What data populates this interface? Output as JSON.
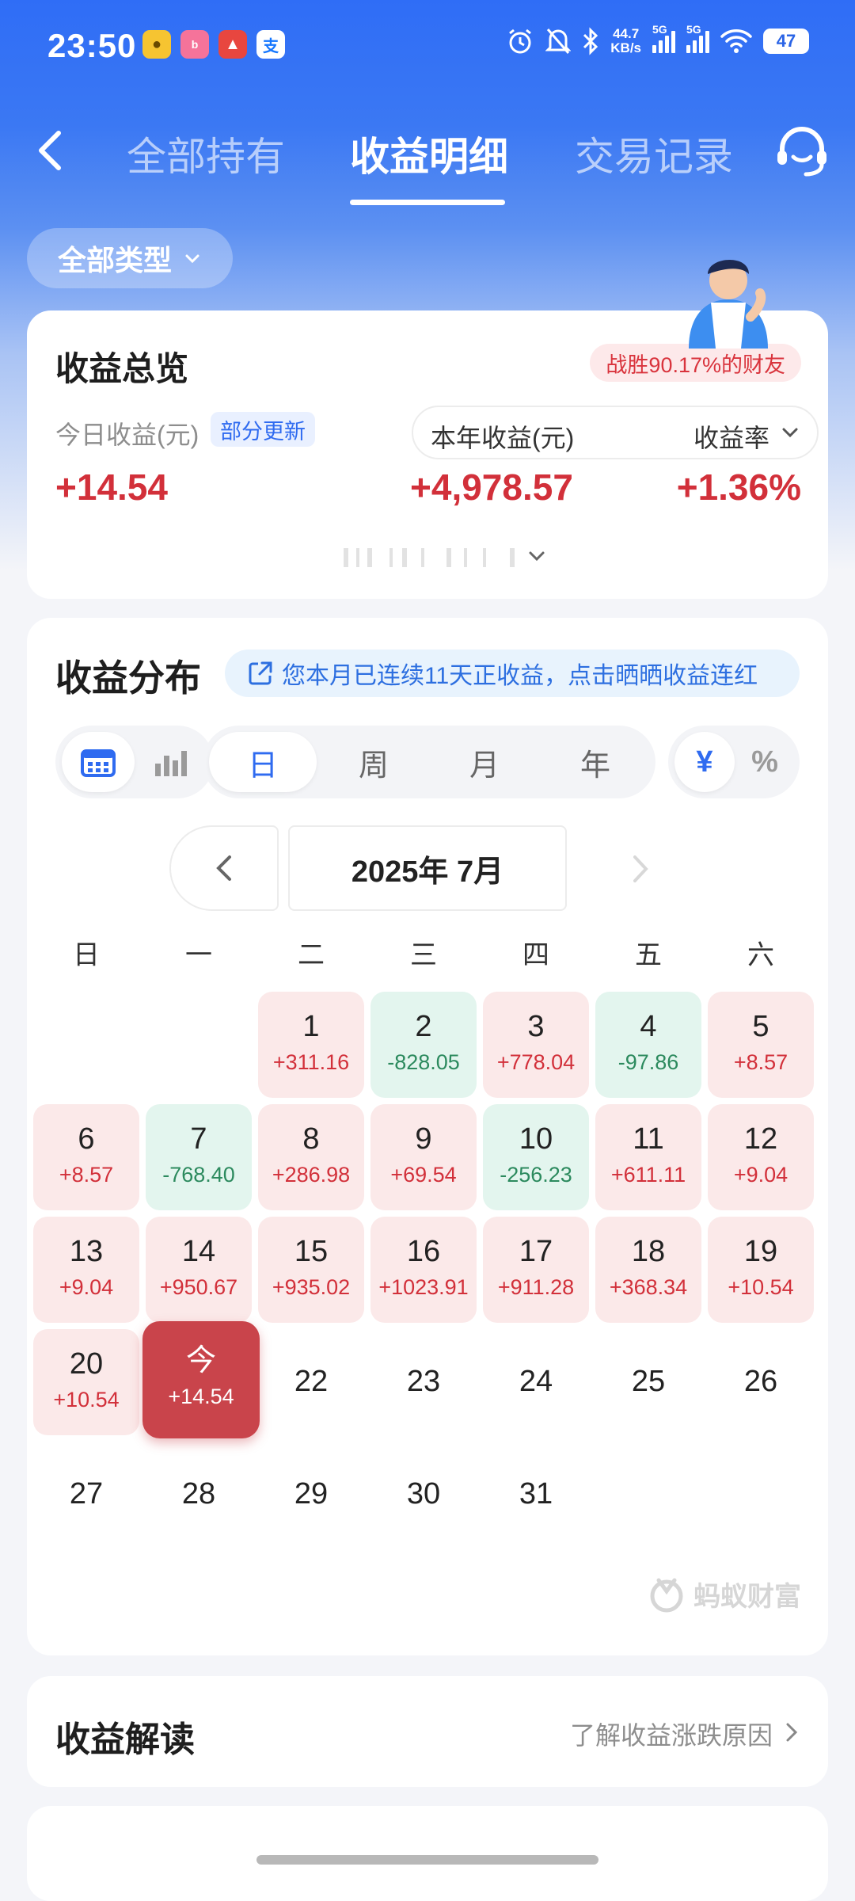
{
  "status_bar": {
    "time": "23:50",
    "net_speed_value": "44.7",
    "net_speed_unit": "KB/s",
    "signal_1": "5G",
    "signal_2": "5G",
    "battery": "47",
    "app_icons": [
      "calendar-app-icon",
      "bilibili-app-icon",
      "toutiao-app-icon",
      "alipay-app-icon"
    ],
    "status_icons": [
      "alarm-icon",
      "mute-bell-icon",
      "bluetooth-icon",
      "wifi-icon"
    ]
  },
  "nav": {
    "tabs": [
      {
        "label": "全部持有",
        "active": false
      },
      {
        "label": "收益明细",
        "active": true
      },
      {
        "label": "交易记录",
        "active": false
      }
    ]
  },
  "filter": {
    "type_label": "全部类型"
  },
  "overview": {
    "title": "收益总览",
    "beat_badge": "战胜90.17%的财友",
    "today_label": "今日收益(元)",
    "partial_badge": "部分更新",
    "today_value": "+14.54",
    "year_label": "本年收益(元)",
    "rate_label": "收益率",
    "year_value": "+4,978.57",
    "rate_value": "+1.36%"
  },
  "distribution": {
    "title": "收益分布",
    "streak_text": "您本月已连续11天正收益，点击晒晒收益连红",
    "view_icons": [
      "calendar-view-icon",
      "bar-chart-view-icon"
    ],
    "periods": [
      {
        "label": "日",
        "active": true
      },
      {
        "label": "周",
        "active": false
      },
      {
        "label": "月",
        "active": false
      },
      {
        "label": "年",
        "active": false
      }
    ],
    "units": [
      {
        "label": "¥",
        "active": true
      },
      {
        "label": "%",
        "active": false
      }
    ],
    "month_label": "2025年 7月",
    "weekdays": [
      "日",
      "一",
      "二",
      "三",
      "四",
      "五",
      "六"
    ],
    "first_weekday_index": 2,
    "days": [
      {
        "d": "1",
        "v": "+311.16",
        "trend": "up"
      },
      {
        "d": "2",
        "v": "-828.05",
        "trend": "down"
      },
      {
        "d": "3",
        "v": "+778.04",
        "trend": "up"
      },
      {
        "d": "4",
        "v": "-97.86",
        "trend": "down"
      },
      {
        "d": "5",
        "v": "+8.57",
        "trend": "up"
      },
      {
        "d": "6",
        "v": "+8.57",
        "trend": "up"
      },
      {
        "d": "7",
        "v": "-768.40",
        "trend": "down"
      },
      {
        "d": "8",
        "v": "+286.98",
        "trend": "up"
      },
      {
        "d": "9",
        "v": "+69.54",
        "trend": "up"
      },
      {
        "d": "10",
        "v": "-256.23",
        "trend": "down"
      },
      {
        "d": "11",
        "v": "+611.11",
        "trend": "up"
      },
      {
        "d": "12",
        "v": "+9.04",
        "trend": "up"
      },
      {
        "d": "13",
        "v": "+9.04",
        "trend": "up"
      },
      {
        "d": "14",
        "v": "+950.67",
        "trend": "up"
      },
      {
        "d": "15",
        "v": "+935.02",
        "trend": "up"
      },
      {
        "d": "16",
        "v": "+1023.91",
        "trend": "up"
      },
      {
        "d": "17",
        "v": "+911.28",
        "trend": "up"
      },
      {
        "d": "18",
        "v": "+368.34",
        "trend": "up"
      },
      {
        "d": "19",
        "v": "+10.54",
        "trend": "up"
      },
      {
        "d": "20",
        "v": "+10.54",
        "trend": "up"
      },
      {
        "d": "今",
        "v": "+14.54",
        "trend": "today"
      },
      {
        "d": "22",
        "v": "",
        "trend": "none"
      },
      {
        "d": "23",
        "v": "",
        "trend": "none"
      },
      {
        "d": "24",
        "v": "",
        "trend": "none"
      },
      {
        "d": "25",
        "v": "",
        "trend": "none"
      },
      {
        "d": "26",
        "v": "",
        "trend": "none"
      },
      {
        "d": "27",
        "v": "",
        "trend": "none"
      },
      {
        "d": "28",
        "v": "",
        "trend": "none"
      },
      {
        "d": "29",
        "v": "",
        "trend": "none"
      },
      {
        "d": "30",
        "v": "",
        "trend": "none"
      },
      {
        "d": "31",
        "v": "",
        "trend": "none"
      }
    ],
    "watermark": "蚂蚁财富"
  },
  "interpretation": {
    "title": "收益解读",
    "link": "了解收益涨跌原因"
  },
  "colors": {
    "brand_blue": "#2f6df6",
    "gain_red": "#d2303a",
    "loss_green": "#2c8a5e",
    "today_bg": "#c9444b"
  }
}
